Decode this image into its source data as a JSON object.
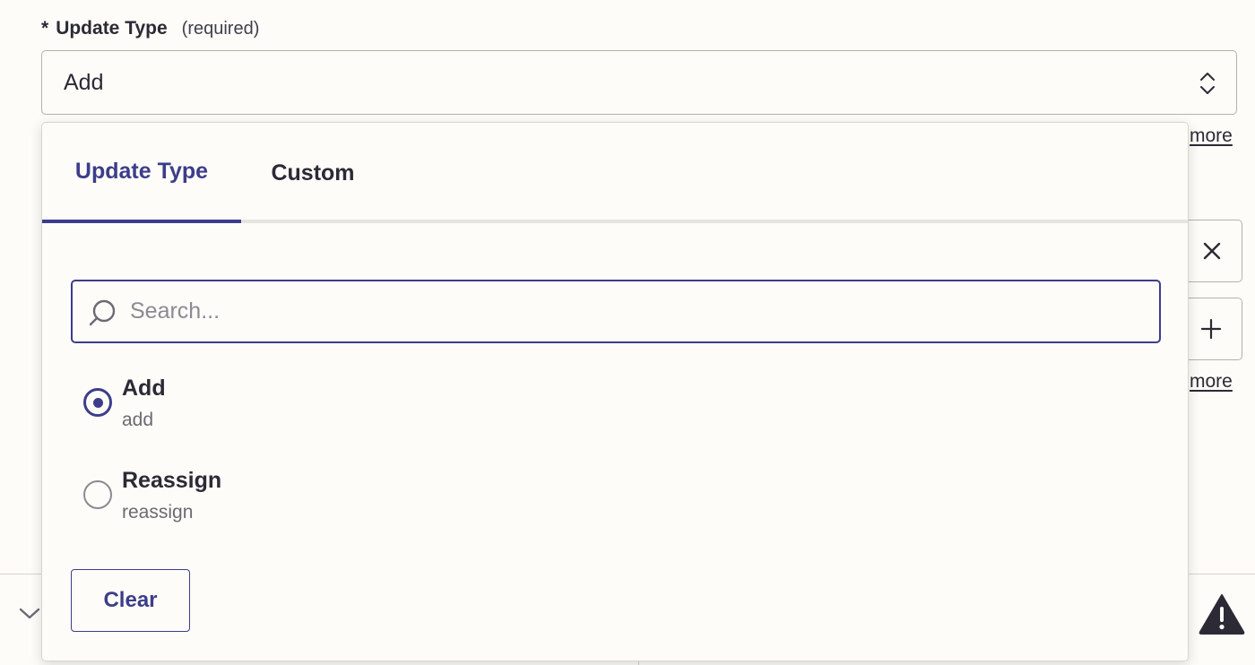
{
  "field": {
    "asterisk": "*",
    "label": "Update Type",
    "required_text": "(required)",
    "selected_value": "Add"
  },
  "background": {
    "more_link_1": "more",
    "more_link_2": "more"
  },
  "dropdown": {
    "tabs": [
      {
        "label": "Update Type",
        "active": true
      },
      {
        "label": "Custom",
        "active": false
      }
    ],
    "search_placeholder": "Search...",
    "options": [
      {
        "label": "Add",
        "value": "add",
        "selected": true
      },
      {
        "label": "Reassign",
        "value": "reassign",
        "selected": false
      }
    ],
    "clear_label": "Clear"
  },
  "colors": {
    "accent": "#3c3d8a",
    "background": "#fdfcf8",
    "text": "#2b2a35",
    "muted": "#6b6a73",
    "border": "#b5b2a6"
  },
  "icons": [
    "chevron-up-down-icon",
    "close-icon",
    "plus-icon",
    "search-icon",
    "chevron-down-icon",
    "warning-icon"
  ]
}
